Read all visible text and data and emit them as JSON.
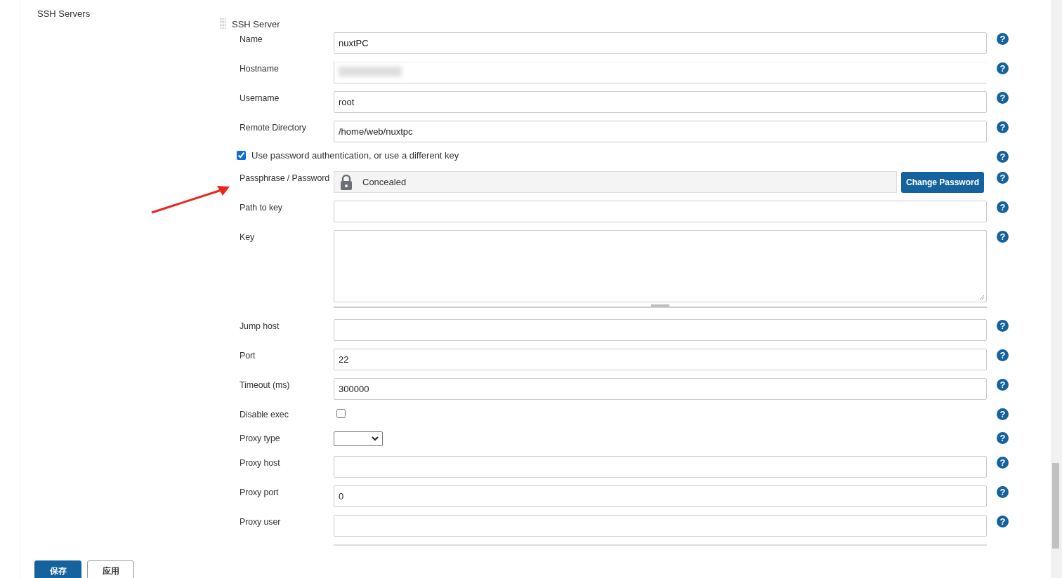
{
  "sidebar_label": "SSH Servers",
  "section": {
    "title": "SSH Server",
    "fields": [
      {
        "kind": "text",
        "label": "Name",
        "value": "nuxtPC",
        "help": "?"
      },
      {
        "kind": "redacted",
        "label": "Hostname",
        "help": "?"
      },
      {
        "kind": "text",
        "label": "Username",
        "value": "root",
        "help": "?"
      },
      {
        "kind": "text",
        "label": "Remote Directory",
        "value": "/home/web/nuxtpc",
        "help": "?"
      },
      {
        "kind": "check_line",
        "label": "Use password authentication, or use a different key",
        "checked": true,
        "help": "?"
      },
      {
        "kind": "password",
        "label": "Passphrase / Password",
        "value": "Concealed",
        "button": "Change Password",
        "help": "?"
      },
      {
        "kind": "text",
        "label": "Path to key",
        "help": "?"
      },
      {
        "kind": "textarea",
        "label": "Key",
        "help": "?"
      },
      {
        "kind": "text",
        "label": "Jump host",
        "help": "?"
      },
      {
        "kind": "text",
        "label": "Port",
        "value": "22",
        "help": "?"
      },
      {
        "kind": "text",
        "label": "Timeout (ms)",
        "value": "300000",
        "help": "?"
      },
      {
        "kind": "checkbox",
        "label": "Disable exec",
        "checked": false,
        "help": "?"
      },
      {
        "kind": "select",
        "label": "Proxy type",
        "help": "?"
      },
      {
        "kind": "text",
        "label": "Proxy host",
        "help": "?"
      },
      {
        "kind": "text",
        "label": "Proxy port",
        "value": "0",
        "help": "?"
      },
      {
        "kind": "text",
        "label": "Proxy user",
        "help": "?"
      }
    ]
  },
  "buttons": [
    {
      "label": "保存",
      "primary": true
    },
    {
      "label": "应用",
      "primary": false
    }
  ]
}
